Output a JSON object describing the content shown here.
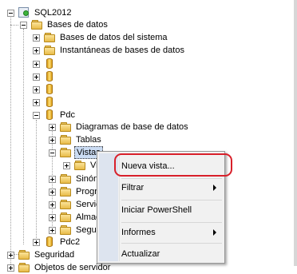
{
  "tree": {
    "server": "SQL2012",
    "databases_folder": "Bases de datos",
    "system_databases": "Bases de datos del sistema",
    "snapshots": "Instantáneas de bases de datos",
    "pdc": "Pdc",
    "diagrams": "Diagramas de base de datos",
    "tables": "Tablas",
    "views": "Vistas",
    "views_child": "Vi",
    "synonyms": "Sinón",
    "programmability": "Progr",
    "service": "Servic",
    "storage": "Almac",
    "security_inner": "Segur",
    "pdc2": "Pdc2",
    "security": "Seguridad",
    "server_objects": "Objetos de servidor"
  },
  "context_menu": {
    "new_view": "Nueva vista...",
    "filter": "Filtrar",
    "powershell": "Iniciar PowerShell",
    "reports": "Informes",
    "refresh": "Actualizar"
  },
  "colors": {
    "highlight_ring": "#d8202a",
    "menu_gutter": "#dde4ef",
    "selection": "#cbdcf3"
  }
}
